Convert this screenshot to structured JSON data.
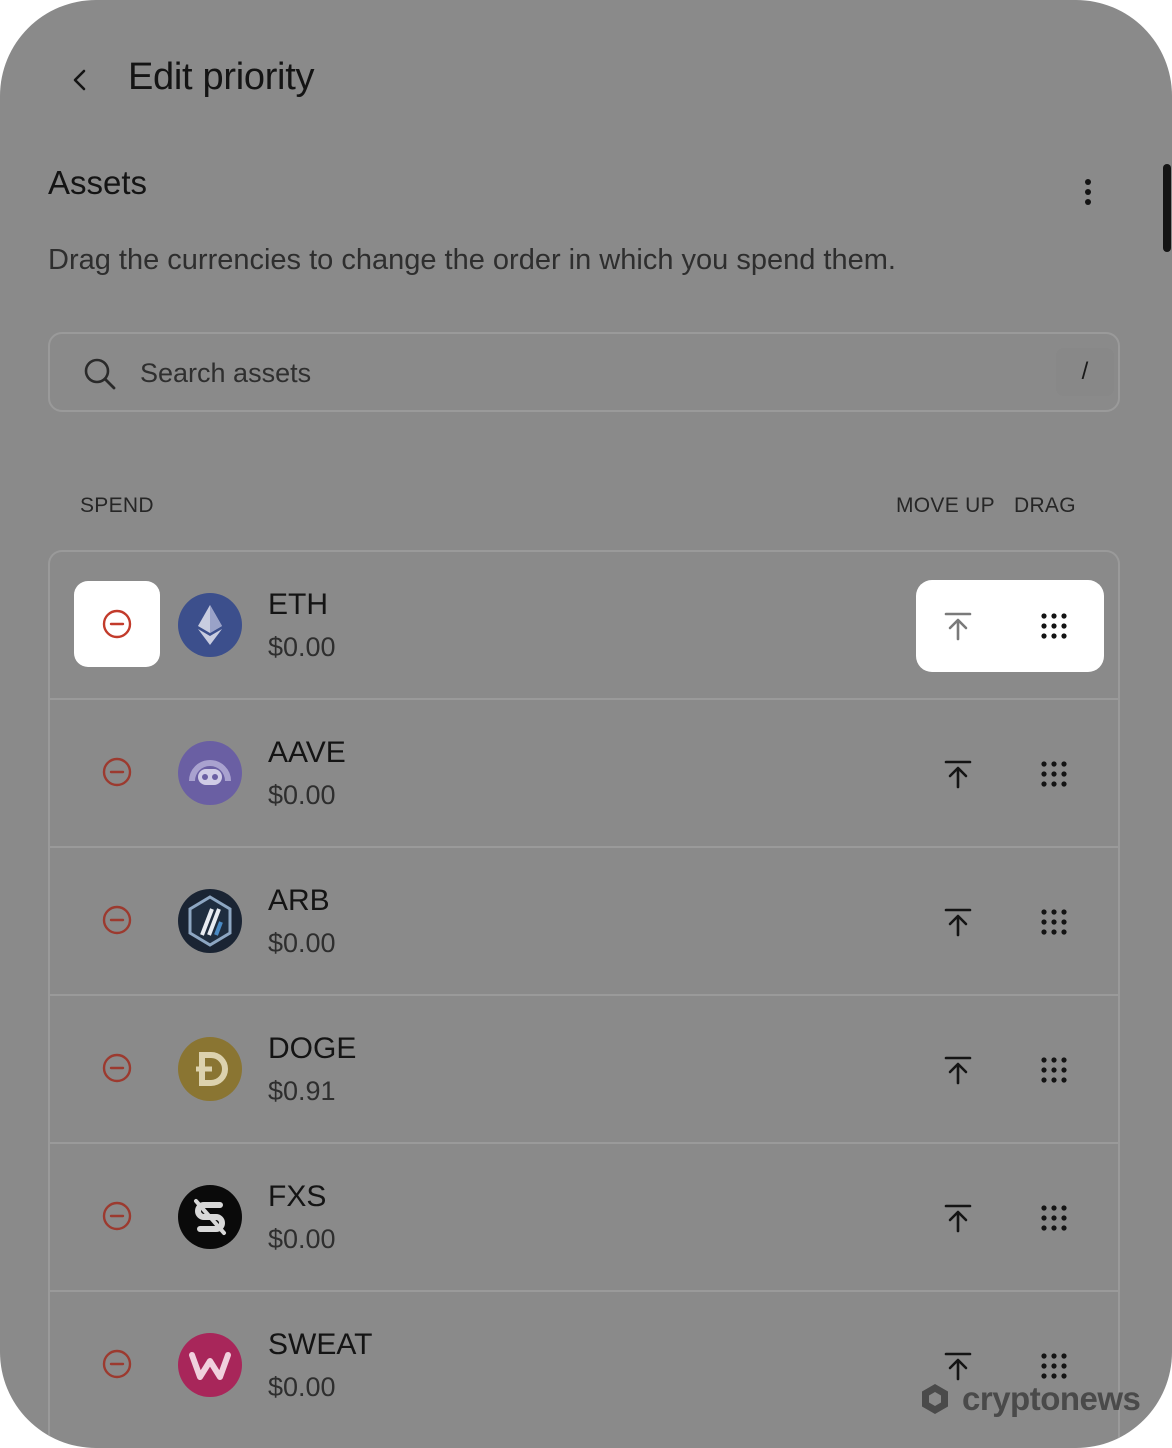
{
  "header": {
    "title": "Edit priority"
  },
  "assets_section": {
    "title": "Assets",
    "description": "Drag the currencies to change the order in which you spend them."
  },
  "search": {
    "placeholder": "Search assets",
    "shortcut": "/"
  },
  "columns": {
    "spend": "SPEND",
    "move_up": "MOVE UP",
    "drag": "DRAG"
  },
  "assets": [
    {
      "name": "ETH",
      "value": "$0.00",
      "icon": "ethereum-icon",
      "color": "#3c4f8c",
      "highlighted": true
    },
    {
      "name": "AAVE",
      "value": "$0.00",
      "icon": "aave-icon",
      "color": "#6a5fa3",
      "highlighted": false
    },
    {
      "name": "ARB",
      "value": "$0.00",
      "icon": "arbitrum-icon",
      "color": "#1a2433",
      "highlighted": false
    },
    {
      "name": "DOGE",
      "value": "$0.91",
      "icon": "dogecoin-icon",
      "color": "#8a7532",
      "highlighted": false
    },
    {
      "name": "FXS",
      "value": "$0.00",
      "icon": "frax-share-icon",
      "color": "#0a0a0a",
      "highlighted": false
    },
    {
      "name": "SWEAT",
      "value": "$0.00",
      "icon": "sweat-icon",
      "color": "#a8265a",
      "highlighted": false
    }
  ],
  "watermark": {
    "text": "cryptonews"
  },
  "colors": {
    "accent_red": "#c23b2b",
    "overlay": "#8a8a8a"
  }
}
